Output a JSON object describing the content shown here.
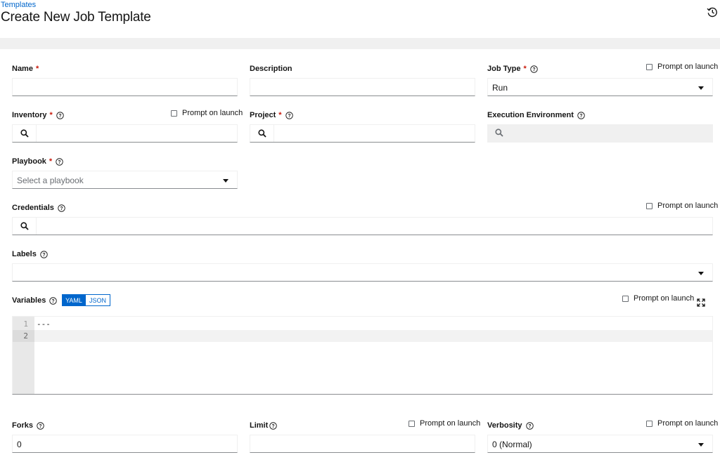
{
  "breadcrumb": "Templates",
  "page_title": "Create New Job Template",
  "icons": {
    "history": "history-icon",
    "help": "question-circle-icon",
    "search": "search-icon",
    "caret": "caret-down-icon",
    "expand": "expand-icon"
  },
  "prompt_on_launch": "Prompt on launch",
  "fields": {
    "name": {
      "label": "Name",
      "required": "*",
      "value": ""
    },
    "description": {
      "label": "Description",
      "value": ""
    },
    "job_type": {
      "label": "Job Type",
      "required": "*",
      "value": "Run"
    },
    "inventory": {
      "label": "Inventory",
      "required": "*",
      "value": ""
    },
    "project": {
      "label": "Project",
      "required": "*",
      "value": ""
    },
    "execution_environment": {
      "label": "Execution Environment",
      "value": ""
    },
    "playbook": {
      "label": "Playbook",
      "required": "*",
      "placeholder": "Select a playbook"
    },
    "credentials": {
      "label": "Credentials",
      "value": ""
    },
    "labels": {
      "label": "Labels",
      "value": ""
    },
    "variables": {
      "label": "Variables",
      "mode_yaml": "YAML",
      "mode_json": "JSON",
      "selected_mode": "YAML",
      "line_numbers": [
        "1",
        "2"
      ],
      "lines": [
        "---",
        ""
      ]
    },
    "forks": {
      "label": "Forks",
      "value": "0"
    },
    "limit": {
      "label": "Limit",
      "value": ""
    },
    "verbosity": {
      "label": "Verbosity",
      "value": "0 (Normal)"
    }
  },
  "colors": {
    "accent": "#0066cc",
    "required": "#c9190b",
    "band": "#f0f0f0"
  }
}
